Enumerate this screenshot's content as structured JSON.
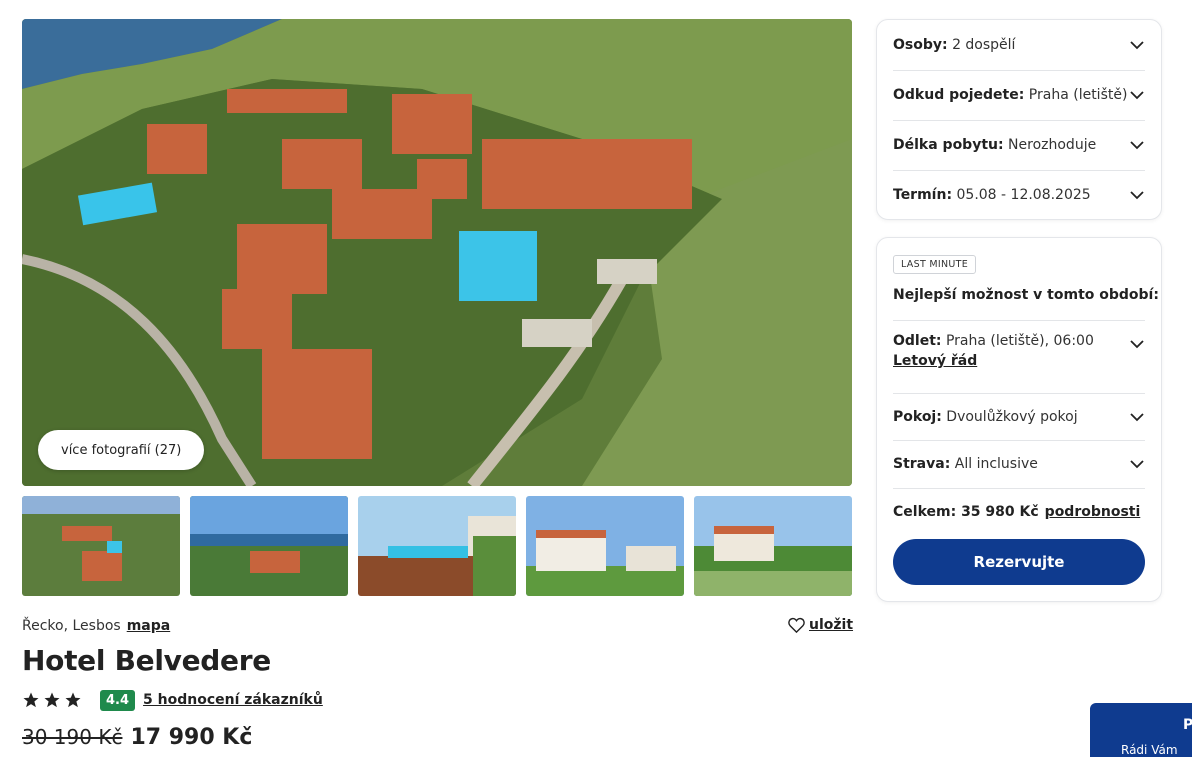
{
  "gallery": {
    "more_photos_label": "více fotografií (27)"
  },
  "hotel": {
    "location": "Řecko, Lesbos",
    "map_link": "mapa",
    "save_label": "uložit",
    "name": "Hotel Belvedere",
    "stars": 3,
    "score": "4.4",
    "reviews_label": "5 hodnocení zákazníků",
    "old_price": "30 190 Kč",
    "new_price": "17 990 Kč"
  },
  "search": {
    "persons_label": "Osoby:",
    "persons_value": "2 dospělí",
    "from_label": "Odkud pojedete:",
    "from_value": "Praha (letiště)",
    "length_label": "Délka pobytu:",
    "length_value": "Nerozhoduje",
    "date_label": "Termín:",
    "date_value": "05.08 - 12.08.2025"
  },
  "offer": {
    "badge": "LAST MINUTE",
    "heading": "Nejlepší možnost v tomto období:",
    "departure_label": "Odlet:",
    "departure_value": "Praha (letiště), 06:00",
    "flight_link": "Letový řád",
    "room_label": "Pokoj:",
    "room_value": "Dvoulůžkový pokoj",
    "board_label": "Strava:",
    "board_value": "All inclusive",
    "total_label": "Celkem:",
    "total_value": "35 980 Kč",
    "details_link": "podrobnosti",
    "reserve_label": "Rezervujte"
  },
  "chat": {
    "title": "P",
    "text": "Rádi Vám"
  },
  "colors": {
    "primary": "#0f3b8f",
    "score_green": "#1f8a4c"
  }
}
